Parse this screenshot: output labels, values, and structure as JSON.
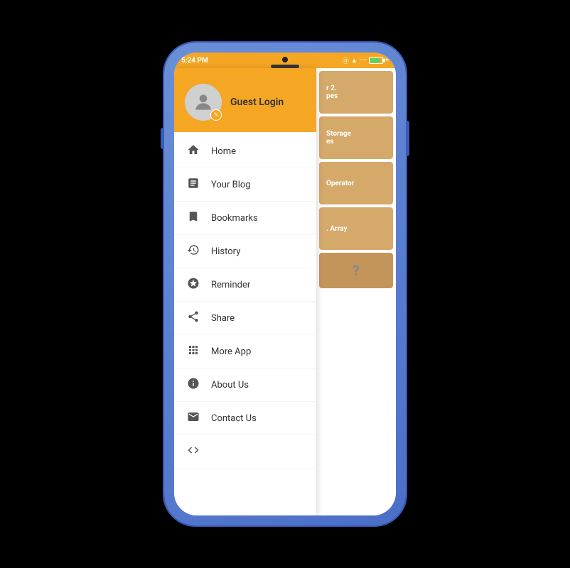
{
  "statusBar": {
    "time": "5:24 PM",
    "icons": "⓪ ▲ ···· ████ +"
  },
  "drawer": {
    "header": {
      "username": "Guest Login",
      "avatarLabel": "user avatar"
    },
    "menuItems": [
      {
        "id": "home",
        "label": "Home",
        "icon": "home"
      },
      {
        "id": "your-blog",
        "label": "Your Blog",
        "icon": "blog"
      },
      {
        "id": "bookmarks",
        "label": "Bookmarks",
        "icon": "bookmark"
      },
      {
        "id": "history",
        "label": "History",
        "icon": "history"
      },
      {
        "id": "reminder",
        "label": "Reminder",
        "icon": "reminder"
      },
      {
        "id": "share",
        "label": "Share",
        "icon": "share"
      },
      {
        "id": "more-app",
        "label": "More App",
        "icon": "apps"
      },
      {
        "id": "about-us",
        "label": "About Us",
        "icon": "info"
      },
      {
        "id": "contact-us",
        "label": "Contact Us",
        "icon": "email"
      },
      {
        "id": "code",
        "label": "",
        "icon": "code"
      }
    ]
  },
  "contentCards": [
    {
      "text": "r 2.\npes"
    },
    {
      "text": "Storage\nes"
    },
    {
      "text": "Operator"
    },
    {
      "text": ". Array"
    },
    {
      "text": "?"
    }
  ]
}
